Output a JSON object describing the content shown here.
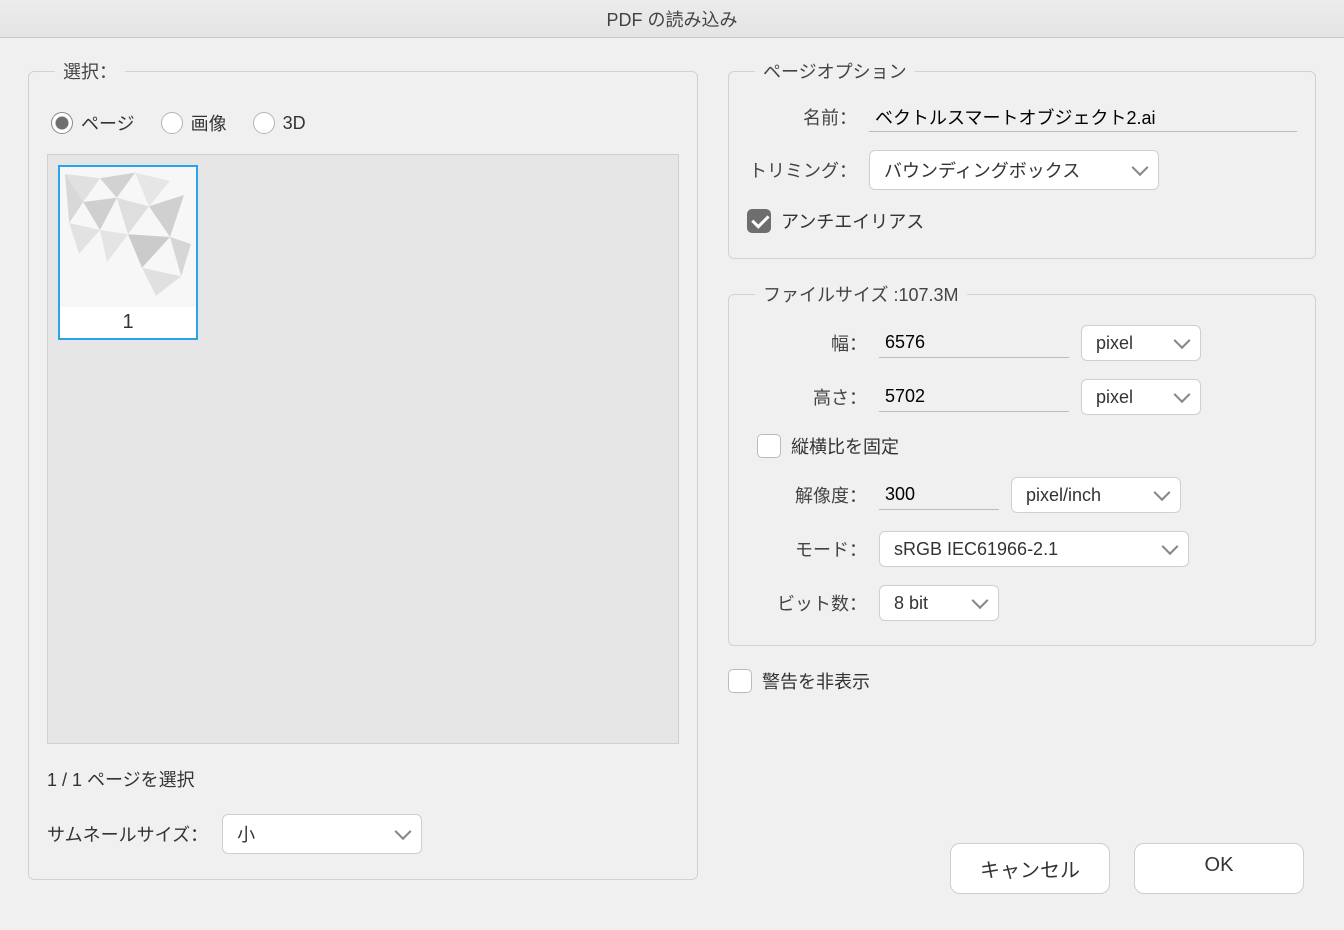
{
  "title": "PDF の読み込み",
  "select_group": {
    "legend": "選択：",
    "radios": {
      "page": "ページ",
      "image": "画像",
      "threeD": "3D"
    },
    "thumbnail_label": "1",
    "pages_selected_text": "1 / 1 ページを選択",
    "thumbnail_size_label": "サムネールサイズ：",
    "thumbnail_size_value": "小"
  },
  "page_options": {
    "legend": "ページオプション",
    "name_label": "名前：",
    "name_value": "ベクトルスマートオブジェクト2.ai",
    "trim_label": "トリミング：",
    "trim_value": "バウンディングボックス",
    "antialias_label": "アンチエイリアス"
  },
  "file_size": {
    "legend": "ファイルサイズ :107.3M",
    "width_label": "幅：",
    "width_value": "6576",
    "width_unit": "pixel",
    "height_label": "高さ：",
    "height_value": "5702",
    "height_unit": "pixel",
    "constrain_label": "縦横比を固定",
    "resolution_label": "解像度：",
    "resolution_value": "300",
    "resolution_unit": "pixel/inch",
    "mode_label": "モード：",
    "mode_value": "sRGB IEC61966-2.1",
    "bit_label": "ビット数：",
    "bit_value": "8 bit"
  },
  "suppress_warnings_label": "警告を非表示",
  "buttons": {
    "cancel": "キャンセル",
    "ok": "OK"
  }
}
